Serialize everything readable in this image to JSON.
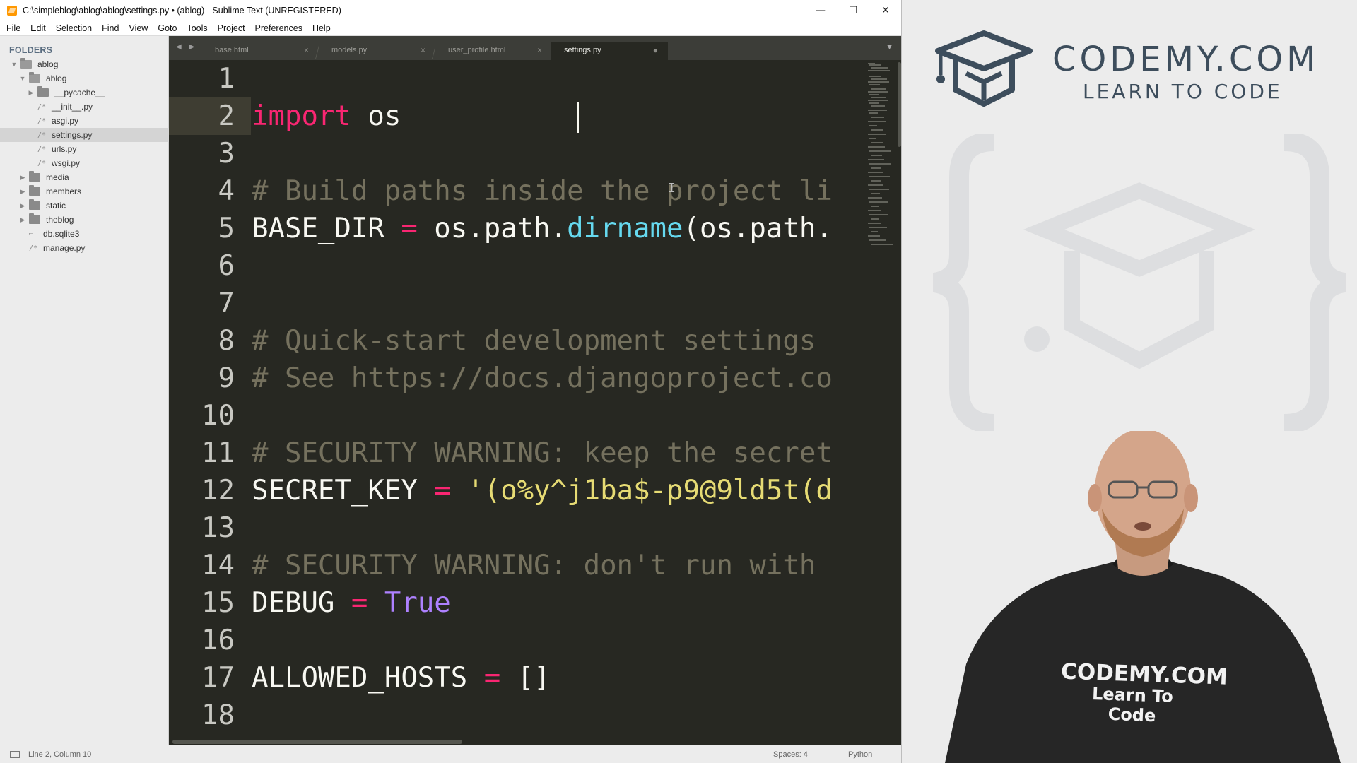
{
  "window": {
    "title": "C:\\simpleblog\\ablog\\ablog\\settings.py • (ablog) - Sublime Text (UNREGISTERED)",
    "min_glyph": "—",
    "max_glyph": "☐",
    "close_glyph": "✕"
  },
  "menu": [
    "File",
    "Edit",
    "Selection",
    "Find",
    "View",
    "Goto",
    "Tools",
    "Project",
    "Preferences",
    "Help"
  ],
  "sidebar": {
    "heading": "FOLDERS",
    "items": [
      {
        "label": "ablog",
        "type": "folder",
        "state": "open"
      },
      {
        "label": "ablog",
        "type": "folder",
        "state": "open"
      },
      {
        "label": "__pycache__",
        "type": "folder",
        "state": "closed"
      },
      {
        "label": "__init__.py",
        "type": "file"
      },
      {
        "label": "asgi.py",
        "type": "file"
      },
      {
        "label": "settings.py",
        "type": "file",
        "selected": true
      },
      {
        "label": "urls.py",
        "type": "file"
      },
      {
        "label": "wsgi.py",
        "type": "file"
      },
      {
        "label": "media",
        "type": "folder",
        "state": "closed"
      },
      {
        "label": "members",
        "type": "folder",
        "state": "closed"
      },
      {
        "label": "static",
        "type": "folder",
        "state": "closed"
      },
      {
        "label": "theblog",
        "type": "folder",
        "state": "closed"
      },
      {
        "label": "db.sqlite3",
        "type": "file"
      },
      {
        "label": "manage.py",
        "type": "file"
      }
    ]
  },
  "tabs": {
    "nav": "◀ ▶",
    "items": [
      {
        "label": "base.html",
        "close": "×"
      },
      {
        "label": "models.py",
        "close": "×"
      },
      {
        "label": "user_profile.html",
        "close": "×"
      },
      {
        "label": "settings.py",
        "close": "●",
        "active": true
      }
    ],
    "dropdown": "▼"
  },
  "editor": {
    "current_line": 2,
    "lines": [
      {
        "n": "1",
        "tokens": []
      },
      {
        "n": "2",
        "tokens": [
          {
            "t": "import",
            "c": "kw"
          },
          {
            "t": " os",
            "c": ""
          }
        ]
      },
      {
        "n": "3",
        "tokens": []
      },
      {
        "n": "4",
        "tokens": [
          {
            "t": "# Build paths inside the project li",
            "c": "cm"
          }
        ]
      },
      {
        "n": "5",
        "tokens": [
          {
            "t": "BASE_DIR ",
            "c": ""
          },
          {
            "t": "=",
            "c": "kw"
          },
          {
            "t": " os.path.",
            "c": ""
          },
          {
            "t": "dirname",
            "c": "fn"
          },
          {
            "t": "(os.path.",
            "c": ""
          }
        ]
      },
      {
        "n": "6",
        "tokens": []
      },
      {
        "n": "7",
        "tokens": []
      },
      {
        "n": "8",
        "tokens": [
          {
            "t": "# Quick-start development settings",
            "c": "cm"
          }
        ]
      },
      {
        "n": "9",
        "tokens": [
          {
            "t": "# See https://docs.djangoproject.co",
            "c": "cm"
          }
        ]
      },
      {
        "n": "10",
        "tokens": []
      },
      {
        "n": "11",
        "tokens": [
          {
            "t": "# SECURITY WARNING: keep the secret",
            "c": "cm"
          }
        ]
      },
      {
        "n": "12",
        "tokens": [
          {
            "t": "SECRET_KEY ",
            "c": ""
          },
          {
            "t": "=",
            "c": "kw"
          },
          {
            "t": " '(o%y^j1ba$-p9@9ld5t(d",
            "c": "st"
          }
        ]
      },
      {
        "n": "13",
        "tokens": []
      },
      {
        "n": "14",
        "tokens": [
          {
            "t": "# SECURITY WARNING: don't run with",
            "c": "cm"
          }
        ]
      },
      {
        "n": "15",
        "tokens": [
          {
            "t": "DEBUG ",
            "c": ""
          },
          {
            "t": "=",
            "c": "kw"
          },
          {
            "t": " ",
            "c": ""
          },
          {
            "t": "True",
            "c": "bl"
          }
        ]
      },
      {
        "n": "16",
        "tokens": []
      },
      {
        "n": "17",
        "tokens": [
          {
            "t": "ALLOWED_HOSTS ",
            "c": ""
          },
          {
            "t": "=",
            "c": "kw"
          },
          {
            "t": " []",
            "c": ""
          }
        ]
      },
      {
        "n": "18",
        "tokens": []
      }
    ]
  },
  "status": {
    "position": "Line 2, Column 10",
    "indentation": "Spaces: 4",
    "syntax": "Python"
  },
  "video": {
    "brand_name": "CODEMY.COM",
    "brand_tagline": "LEARN TO CODE",
    "shirt_line1": "CODEMY.COM",
    "shirt_line2": "Learn To Code"
  },
  "colors": {
    "editor_bg": "#272822",
    "keyword": "#f92672",
    "comment": "#75715e",
    "function": "#66d9ef",
    "string": "#e6db74",
    "constant": "#ae81ff",
    "brand": "#3d4d5c"
  }
}
